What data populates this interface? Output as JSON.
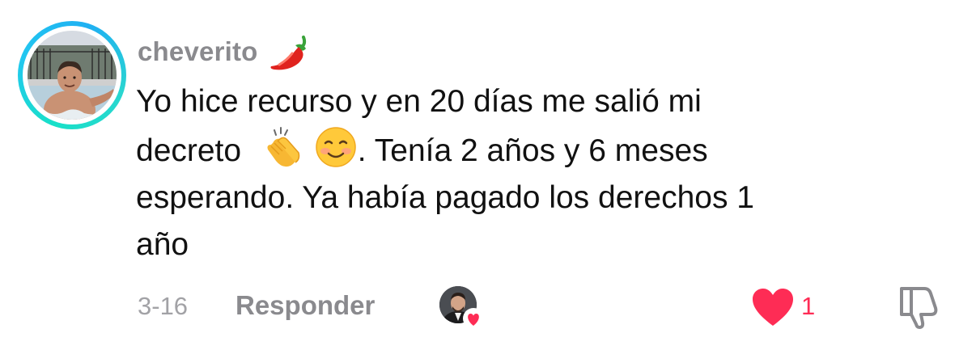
{
  "comment": {
    "username": "cheverito",
    "username_emoji": "chili-pepper-icon",
    "text_line1": "Yo hice recurso y en 20 días me salió mi",
    "text_line2_a": "decreto",
    "text_line2_emoji1": "clapping-hands-icon",
    "text_line2_emoji2": "smiling-face-icon",
    "text_line2_b": ". Tenía 2 años y 6 meses",
    "text_line3": "esperando. Ya había pagado los derechos 1",
    "text_line4": "año"
  },
  "footer": {
    "date": "3-16",
    "reply_label": "Responder",
    "like_count": "1",
    "liked": true,
    "liked_by_creator_icon": "creator-liked-avatar"
  },
  "colors": {
    "username": "#8a8a8e",
    "body_text": "#111111",
    "meta_text": "#a2a2a6",
    "like_red": "#fe2c55",
    "avatar_ring": "#22c7f0"
  }
}
